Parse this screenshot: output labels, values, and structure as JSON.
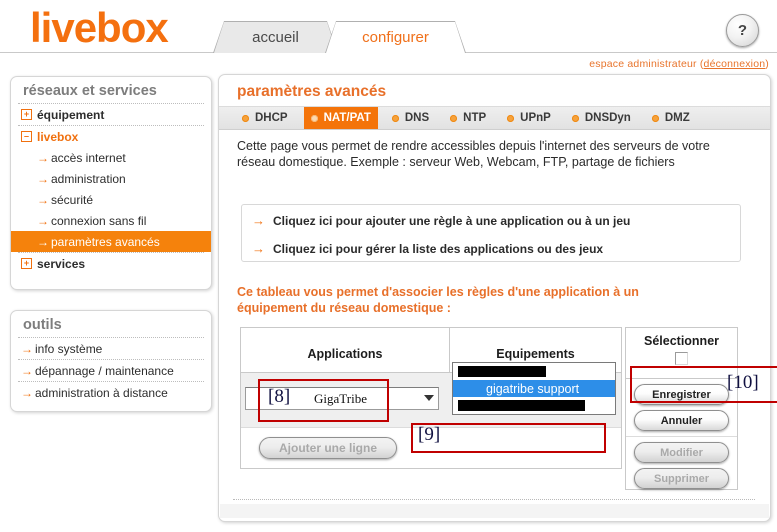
{
  "header": {
    "logo": "livebox",
    "tabs": [
      {
        "label": "accueil"
      },
      {
        "label": "configurer"
      }
    ],
    "help_glyph": "?",
    "admin_prefix": "espace administrateur (",
    "admin_link": "déconnexion",
    "admin_suffix": ")"
  },
  "sidebar": {
    "panel1": {
      "title": "réseaux et services",
      "items": [
        {
          "label": "équipement",
          "glyph": "+"
        },
        {
          "label": "livebox",
          "glyph": "–"
        },
        {
          "label": "accès internet",
          "glyph": "→"
        },
        {
          "label": "administration",
          "glyph": "→"
        },
        {
          "label": "sécurité",
          "glyph": "→"
        },
        {
          "label": "connexion sans fil",
          "glyph": "→"
        },
        {
          "label": "paramètres avancés",
          "glyph": "→"
        },
        {
          "label": "services",
          "glyph": "+"
        }
      ]
    },
    "panel2": {
      "title": "outils",
      "items": [
        {
          "label": "info système",
          "glyph": "→"
        },
        {
          "label": "dépannage / maintenance",
          "glyph": "→"
        },
        {
          "label": "administration à distance",
          "glyph": "→"
        }
      ]
    }
  },
  "main": {
    "title": "paramètres avancés",
    "nav": [
      {
        "label": "DHCP",
        "selected": false
      },
      {
        "label": "NAT/PAT",
        "selected": true
      },
      {
        "label": "DNS",
        "selected": false
      },
      {
        "label": "NTP",
        "selected": false
      },
      {
        "label": "UPnP",
        "selected": false
      },
      {
        "label": "DNSDyn",
        "selected": false
      },
      {
        "label": "DMZ",
        "selected": false
      }
    ],
    "description": "Cette page vous permet de rendre accessibles depuis l'internet des serveurs de votre réseau domestique. Exemple : serveur Web, Webcam, FTP, partage de fichiers",
    "links": [
      {
        "arrow": "→",
        "label": "Cliquez ici pour ajouter une règle à une application ou à un jeu"
      },
      {
        "arrow": "→",
        "label": "Cliquez ici pour gérer la liste des applications ou des jeux"
      }
    ],
    "table_intro": "Ce tableau vous permet d'associer les règles d'une application à un équipement du réseau domestique :",
    "table": {
      "columns": {
        "applications": "Applications",
        "equipements": "Equipements",
        "selectionner": "Sélectionner"
      },
      "application_value": "GigaTribe",
      "equipment_value": "",
      "equipment_options": [
        {
          "label": "",
          "redacted": true,
          "selected": false
        },
        {
          "label": "gigatribe support",
          "redacted": false,
          "selected": true
        },
        {
          "label": "",
          "redacted": true,
          "selected": false
        }
      ],
      "add_row": "Ajouter une ligne",
      "save": "Enregistrer",
      "cancel": "Annuler",
      "modify": "Modifier",
      "delete": "Supprimer"
    }
  },
  "annotations": [
    {
      "label": "[8]"
    },
    {
      "label": "[9]"
    },
    {
      "label": "[10]"
    }
  ],
  "colors": {
    "brand_orange": "#F4700F",
    "accent_orange": "#E8702A",
    "selected_nav": "#F4740A",
    "highlight_blue": "#2D8EE8",
    "annotation_red": "#C00000",
    "annotation_navy": "#101040"
  }
}
